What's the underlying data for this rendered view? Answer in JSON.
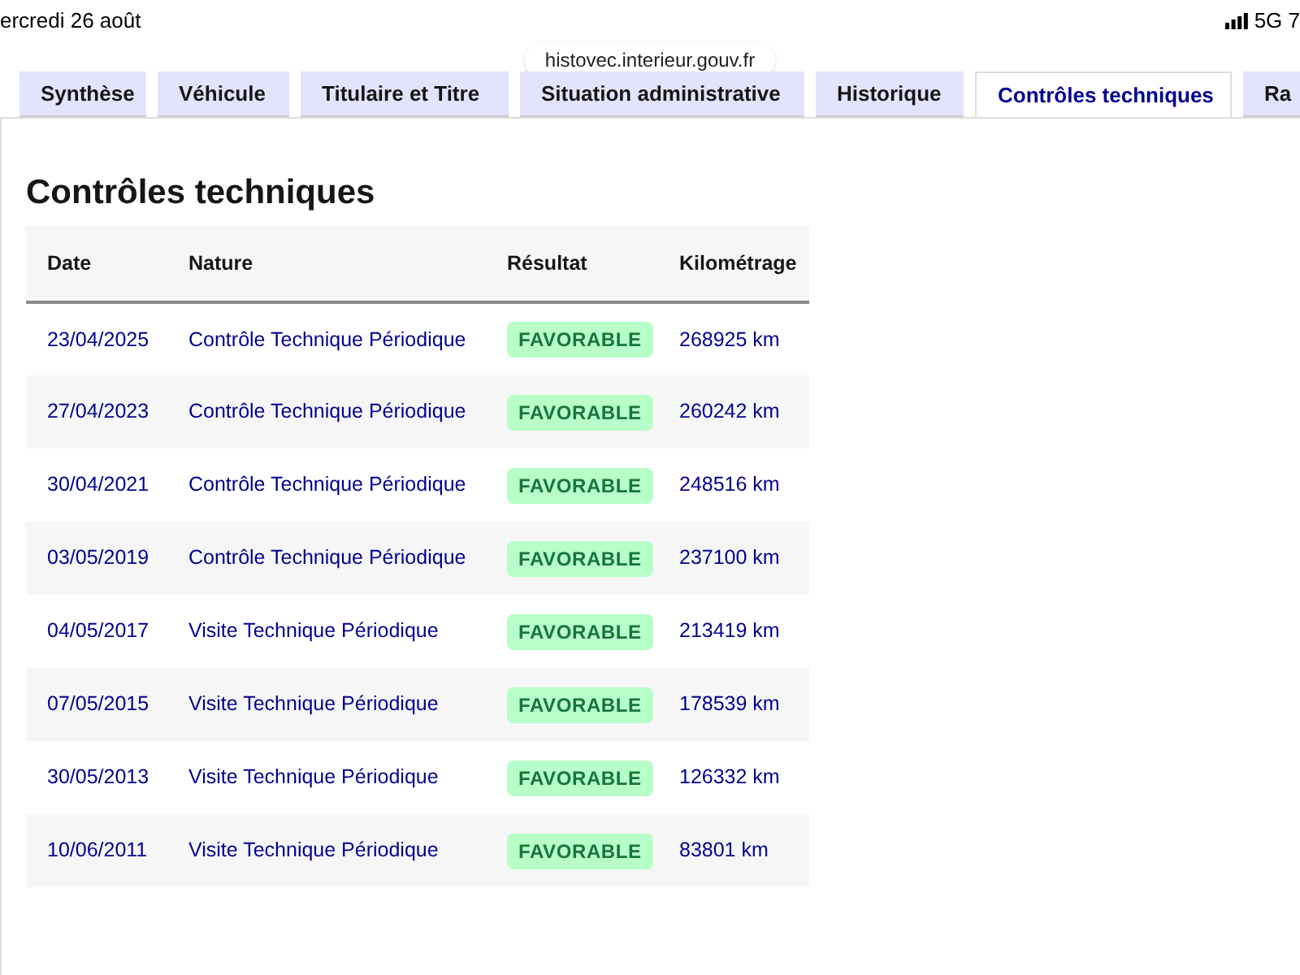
{
  "status_bar": {
    "date": "ercredi 26 août",
    "network": "5G 7"
  },
  "url": "histovec.interieur.gouv.fr",
  "tabs": [
    {
      "label": "Synthèse",
      "selected": false
    },
    {
      "label": "Véhicule",
      "selected": false
    },
    {
      "label": "Titulaire et Titre",
      "selected": false
    },
    {
      "label": "Situation administrative",
      "selected": false
    },
    {
      "label": "Historique",
      "selected": false
    },
    {
      "label": "Contrôles techniques",
      "selected": true
    },
    {
      "label": "Ra",
      "selected": false
    }
  ],
  "title": "Contrôles techniques",
  "table": {
    "columns": [
      "Date",
      "Nature",
      "Résultat",
      "Kilométrage"
    ],
    "rows": [
      {
        "date": "23/04/2025",
        "nature": "Contrôle Technique Périodique",
        "result": "FAVORABLE",
        "km": "268925 km"
      },
      {
        "date": "27/04/2023",
        "nature": "Contrôle Technique Périodique",
        "result": "FAVORABLE",
        "km": "260242 km"
      },
      {
        "date": "30/04/2021",
        "nature": "Contrôle Technique Périodique",
        "result": "FAVORABLE",
        "km": "248516 km"
      },
      {
        "date": "03/05/2019",
        "nature": "Contrôle Technique Périodique",
        "result": "FAVORABLE",
        "km": "237100 km"
      },
      {
        "date": "04/05/2017",
        "nature": "Visite Technique Périodique",
        "result": "FAVORABLE",
        "km": "213419 km"
      },
      {
        "date": "07/05/2015",
        "nature": "Visite Technique Périodique",
        "result": "FAVORABLE",
        "km": "178539 km"
      },
      {
        "date": "30/05/2013",
        "nature": "Visite Technique Périodique",
        "result": "FAVORABLE",
        "km": "126332 km"
      },
      {
        "date": "10/06/2011",
        "nature": "Visite Technique Périodique",
        "result": "FAVORABLE",
        "km": "83801 km"
      }
    ]
  }
}
